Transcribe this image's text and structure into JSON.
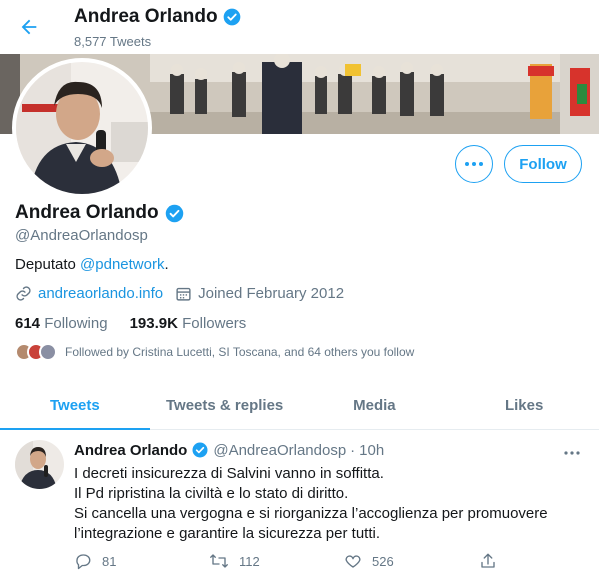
{
  "header": {
    "name": "Andrea Orlando",
    "tweet_count": "8,577 Tweets",
    "back_icon": "arrow-left-icon",
    "verified_icon": "verified-badge-icon"
  },
  "profile": {
    "name": "Andrea Orlando",
    "handle": "@AndreaOrlandosp",
    "bio_prefix": "Deputato ",
    "bio_link": "@pdnetwork",
    "bio_suffix": ".",
    "website": "andreaorlando.info",
    "joined": "Joined February 2012",
    "following_count": "614",
    "following_label": "Following",
    "followers_count": "193.9K",
    "followers_label": "Followers",
    "followed_by": "Followed by Cristina Lucetti, SI Toscana, and 64 others you follow",
    "follow_button": "Follow",
    "more_button_icon": "more-horizontal-icon"
  },
  "tabs": [
    {
      "label": "Tweets",
      "active": true
    },
    {
      "label": "Tweets & replies",
      "active": false
    },
    {
      "label": "Media",
      "active": false
    },
    {
      "label": "Likes",
      "active": false
    }
  ],
  "tweet": {
    "name": "Andrea Orlando",
    "handle": "@AndreaOrlandosp",
    "separator": "·",
    "time": "10h",
    "lines": [
      "I decreti insicurezza di Salvini vanno in soffitta.",
      "Il Pd ripristina la civiltà e lo stato di diritto.",
      "Si cancella una vergogna e si riorganizza l’accoglienza per promuovere l’integrazione e garantire la sicurezza per tutti."
    ],
    "replies": "81",
    "retweets": "112",
    "likes": "526"
  },
  "colors": {
    "accent": "#1da1f2",
    "link": "#1b95e0",
    "muted": "#657786",
    "text": "#14171a"
  }
}
